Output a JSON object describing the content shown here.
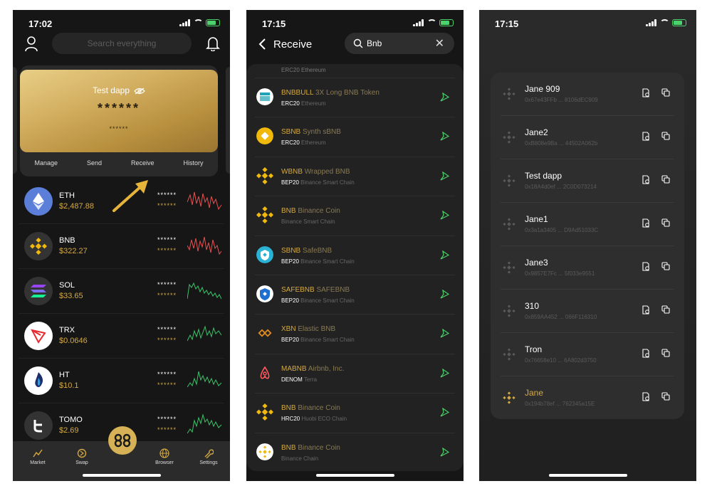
{
  "colors": {
    "gold": "#d4a941",
    "green": "#4bd26b",
    "red": "#e85050",
    "panel": "#2e2e2e"
  },
  "phone1": {
    "time": "17:02",
    "search_placeholder": "Search everything",
    "card": {
      "name": "Test dapp",
      "masked": "******",
      "sub": "******"
    },
    "actions": [
      "Manage",
      "Send",
      "Receive",
      "History"
    ],
    "assets": [
      {
        "symbol": "ETH",
        "price": "$2,487.88",
        "m1": "******",
        "m2": "******",
        "icon": "eth-icon",
        "trend": "red"
      },
      {
        "symbol": "BNB",
        "price": "$322.27",
        "m1": "******",
        "m2": "******",
        "icon": "bnb-icon",
        "trend": "red"
      },
      {
        "symbol": "SOL",
        "price": "$33.65",
        "m1": "******",
        "m2": "******",
        "icon": "sol-icon",
        "trend": "green"
      },
      {
        "symbol": "TRX",
        "price": "$0.0646",
        "m1": "******",
        "m2": "******",
        "icon": "trx-icon",
        "trend": "green"
      },
      {
        "symbol": "HT",
        "price": "$10.1",
        "m1": "******",
        "m2": "******",
        "icon": "ht-icon",
        "trend": "green"
      },
      {
        "symbol": "TOMO",
        "price": "$2.69",
        "m1": "******",
        "m2": "******",
        "icon": "tomo-icon",
        "trend": "green"
      }
    ],
    "nav": [
      "Market",
      "Swap",
      "Browser",
      "Settings"
    ]
  },
  "phone2": {
    "time": "17:15",
    "title": "Receive",
    "search_value": "Bnb",
    "cut_row": "ERC20 Ethereum",
    "tokens": [
      {
        "symbol": "BNBBULL",
        "name": "3X Long BNB Token",
        "standard": "ERC20",
        "chain": "Ethereum",
        "icon": "bnbbull-icon"
      },
      {
        "symbol": "SBNB",
        "name": "Synth sBNB",
        "standard": "ERC20",
        "chain": "Ethereum",
        "icon": "sbnb-icon"
      },
      {
        "symbol": "WBNB",
        "name": "Wrapped BNB",
        "standard": "BEP20",
        "chain": "Binance Smart Chain",
        "icon": "wbnb-icon"
      },
      {
        "symbol": "BNB",
        "name": "Binance Coin",
        "standard": "",
        "chain": "Binance Smart Chain",
        "icon": "bnb-icon"
      },
      {
        "symbol": "SBNB",
        "name": "SafeBNB",
        "standard": "BEP20",
        "chain": "Binance Smart Chain",
        "icon": "safebnb-icon"
      },
      {
        "symbol": "SAFEBNB",
        "name": "SAFEBNB",
        "standard": "BEP20",
        "chain": "Binance Smart Chain",
        "icon": "safebnb2-icon"
      },
      {
        "symbol": "XBN",
        "name": "Elastic BNB",
        "standard": "BEP20",
        "chain": "Binance Smart Chain",
        "icon": "xbn-icon"
      },
      {
        "symbol": "MABNB",
        "name": "Airbnb, Inc.",
        "standard": "DENOM",
        "chain": "Terra",
        "icon": "mabnb-icon"
      },
      {
        "symbol": "BNB",
        "name": "Binance Coin",
        "standard": "HRC20",
        "chain": "Huobi ECO Chain",
        "icon": "bnb-icon"
      },
      {
        "symbol": "BNB",
        "name": "Binance Coin",
        "standard": "",
        "chain": "Binance Chain",
        "icon": "bnb-chain-icon"
      }
    ]
  },
  "phone3": {
    "time": "17:15",
    "accounts": [
      {
        "name": "Jane 909",
        "address": "0x67e43FFb ... 8106dEC909",
        "active": false
      },
      {
        "name": "Jane2",
        "address": "0xB808e9Ba ... 44502A062b",
        "active": false
      },
      {
        "name": "Test dapp",
        "address": "0x18A4d0ef ... 2C0D073214",
        "active": false
      },
      {
        "name": "Jane1",
        "address": "0x3a1a3405 ... D9Ad51033C",
        "active": false
      },
      {
        "name": "Jane3",
        "address": "0x9857E7Fc ... 5f033e9551",
        "active": false
      },
      {
        "name": "310",
        "address": "0x859AA452 ... 066F116310",
        "active": false
      },
      {
        "name": "Tron",
        "address": "0x76658e10 ... 6A802d3750",
        "active": false
      },
      {
        "name": "Jane",
        "address": "0x194b78ef ... 762345a15E",
        "active": true
      }
    ]
  }
}
